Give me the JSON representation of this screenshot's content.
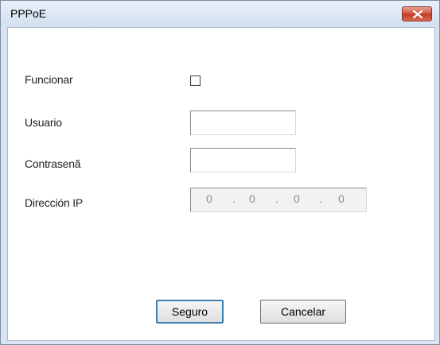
{
  "window": {
    "title": "PPPoE"
  },
  "form": {
    "enable_label": "Funcionar",
    "enable_checked": false,
    "user_label": "Usuario",
    "user_value": "",
    "password_label": "Contrasenã",
    "password_value": "",
    "ip_label": "Dirección IP",
    "ip_octets": [
      "0",
      "0",
      "0",
      "0"
    ],
    "ip_separator": "."
  },
  "buttons": {
    "ok_label": "Seguro",
    "cancel_label": "Cancelar"
  },
  "icons": {
    "close": "close-icon"
  },
  "colors": {
    "close_button": "#d2543f",
    "titlebar": "#dbe6f3",
    "default_button_border": "#3c7fb1"
  }
}
